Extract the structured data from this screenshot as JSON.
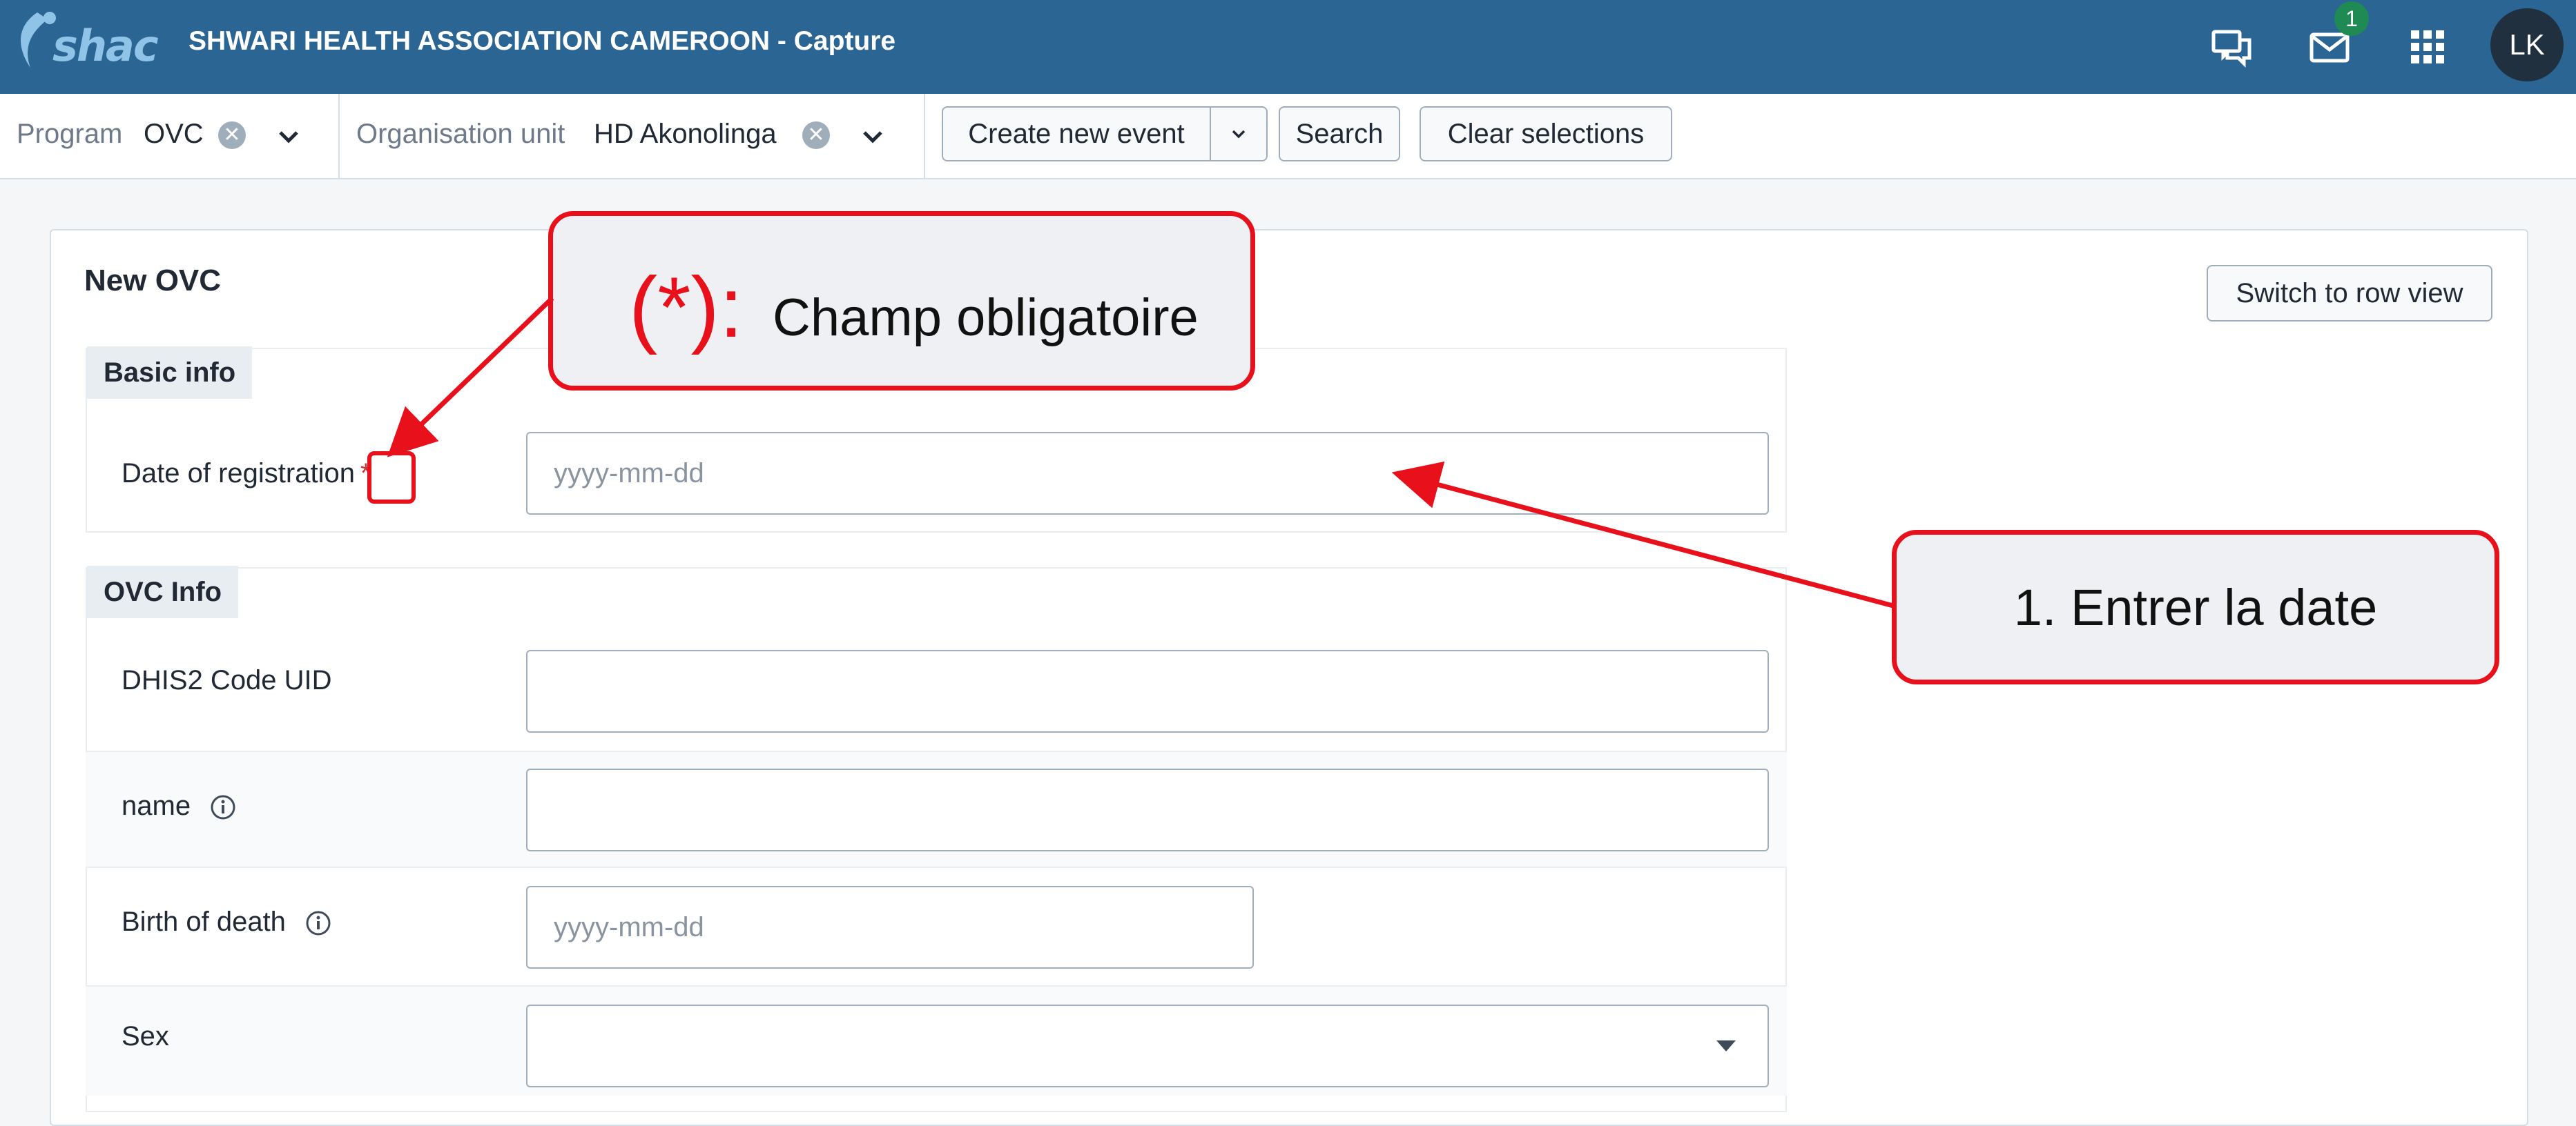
{
  "header": {
    "logo_text": "shac",
    "app_title": "SHWARI HEALTH ASSOCIATION CAMEROON - Capture",
    "icons": [
      "interpretations-icon",
      "messages-icon",
      "apps-grid-icon"
    ],
    "messages_badge": "1",
    "user_initials": "LK"
  },
  "selection_bar": {
    "program_label": "Program",
    "program_value": "OVC",
    "org_unit_label": "Organisation unit",
    "org_unit_value": "HD Akonolinga",
    "create_event_label": "Create new event",
    "search_label": "Search",
    "clear_label": "Clear selections"
  },
  "form": {
    "title": "New OVC",
    "switch_view_label": "Switch to row view",
    "sections": [
      {
        "name": "Basic info",
        "fields": [
          {
            "label": "Date of registration",
            "required": "*",
            "placeholder": "yyyy-mm-dd",
            "value": ""
          }
        ]
      },
      {
        "name": "OVC Info",
        "fields": [
          {
            "label": "DHIS2 Code UID",
            "value": ""
          },
          {
            "label": "name",
            "value": "",
            "info_icon": "info-icon"
          },
          {
            "label": "Birth of death",
            "placeholder": "yyyy-mm-dd",
            "value": "",
            "info_icon": "info-icon"
          },
          {
            "label": "Sex",
            "value": ""
          }
        ]
      }
    ]
  },
  "annotations": {
    "required_marker": "(*):",
    "required_text": "Champ obligatoire",
    "step1": "1. Entrer la date"
  },
  "colors": {
    "header_bg": "#2b6593",
    "annotation_red": "#e8101a",
    "badge_green": "#1f8a53"
  }
}
